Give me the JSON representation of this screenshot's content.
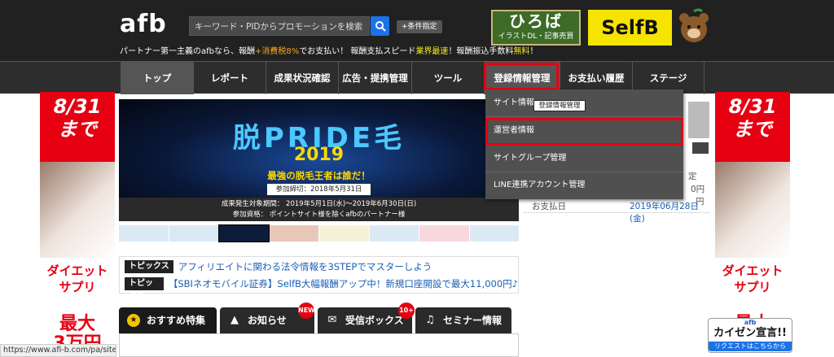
{
  "header": {
    "logo": "afb",
    "search_placeholder": "キーワード・PIDからプロモーションを検索",
    "condition_button": "+条件指定",
    "tagline_pre": "パートナー第一主義のafbなら、報酬",
    "tagline_tax": "+消費税8%",
    "tagline_mid": "でお支払い！ 報酬支払スピード",
    "tagline_speed": "業界最速",
    "tagline_mid2": "！報酬振込手数料",
    "tagline_free": "無料",
    "tagline_end": "！",
    "hiroba_main": "ひろば",
    "hiroba_sub": "イラストDL・記事売買",
    "selfb": "SelfB"
  },
  "nav": {
    "items": [
      "トップ",
      "レポート",
      "成果状況確認",
      "広告・提携管理",
      "ツール",
      "登録情報管理",
      "お支払い履歴",
      "ステージ"
    ]
  },
  "dropdown": {
    "items": [
      "サイト情報",
      "運営者情報",
      "サイトグループ管理",
      "LINE連携アカウント管理"
    ],
    "tooltip": "登録情報管理"
  },
  "banner_left": {
    "top": "8/31\nまで",
    "mid": "ダイエット\nサプリ",
    "bottom": "最大\n3万円"
  },
  "banner_right": {
    "top": "8/31\nまで",
    "mid": "ダイエット\nサプリ",
    "bottom": "最大"
  },
  "hero": {
    "title": "脱PRIDE毛",
    "year": "2019",
    "subtitle": "最強の脱毛王者は誰だ！",
    "period_label": "参加締切：2018年5月31日（金）",
    "detail1": "成果発生対象期間： 2019年5月1日(水)〜2019年6月30日(日)",
    "detail2": "参加資格： ポイントサイト様を除くafbのパートナー様"
  },
  "topics": {
    "label": "トピックス",
    "items": [
      "アフィリエイトに関わる法令情報を3STEPでマスターしよう",
      "【SBIネオモバイル証券】SelfB大幅報酬アップ中！新規口座開設で最大11,000円♪"
    ]
  },
  "tabs": [
    {
      "label": "おすすめ特集",
      "icon": "medal-icon"
    },
    {
      "label": "お知らせ",
      "icon": "cone-icon",
      "badge": "NEW"
    },
    {
      "label": "受信ボックス",
      "icon": "mail-icon",
      "badge": "10+"
    },
    {
      "label": "セミナー情報",
      "icon": "headset-icon"
    }
  ],
  "right_panel": {
    "label_fragment": "定",
    "value_fragment": "0円",
    "value_fragment2": "円",
    "pay_label": "お支払日",
    "pay_date": "2019年06月28日(金)"
  },
  "kaizen": {
    "small": "afb",
    "main": "カイゼン宣言!!",
    "request": "リクエストはこちらから"
  },
  "status_url": "https://www.afi-b.com/pa/siteinfo/",
  "colors": {
    "header_bg": "#212121",
    "accent_red": "#e60012",
    "link_blue": "#1a5fb4"
  }
}
